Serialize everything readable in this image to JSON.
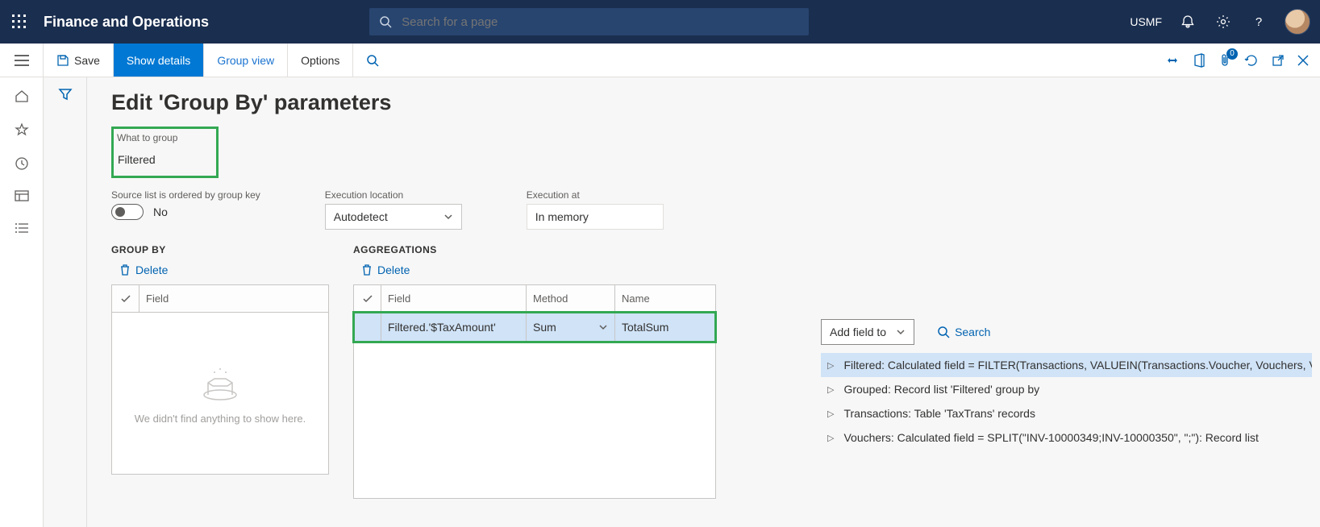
{
  "header": {
    "app_title": "Finance and Operations",
    "search_placeholder": "Search for a page",
    "company": "USMF",
    "notification_badge": "0"
  },
  "commands": {
    "save": "Save",
    "show_details": "Show details",
    "group_view": "Group view",
    "options": "Options"
  },
  "page": {
    "title": "Edit 'Group By' parameters",
    "what_to_group_label": "What to group",
    "what_to_group_value": "Filtered",
    "ordered_label": "Source list is ordered by group key",
    "ordered_value": "No",
    "exec_loc_label": "Execution location",
    "exec_loc_value": "Autodetect",
    "exec_at_label": "Execution at",
    "exec_at_value": "In memory",
    "group_by_title": "GROUP BY",
    "aggregations_title": "AGGREGATIONS",
    "delete": "Delete",
    "field_col": "Field",
    "method_col": "Method",
    "name_col": "Name",
    "empty_msg": "We didn't find anything to show here.",
    "agg_row": {
      "field": "Filtered.'$TaxAmount'",
      "method": "Sum",
      "name": "TotalSum"
    }
  },
  "rightpanel": {
    "add_field": "Add field to",
    "search": "Search",
    "items": [
      "Filtered: Calculated field = FILTER(Transactions, VALUEIN(Transactions.Voucher, Vouchers, V",
      "Grouped: Record list 'Filtered' group by",
      "Transactions: Table 'TaxTrans' records",
      "Vouchers: Calculated field = SPLIT(\"INV-10000349;INV-10000350\", \";\"): Record list"
    ]
  }
}
